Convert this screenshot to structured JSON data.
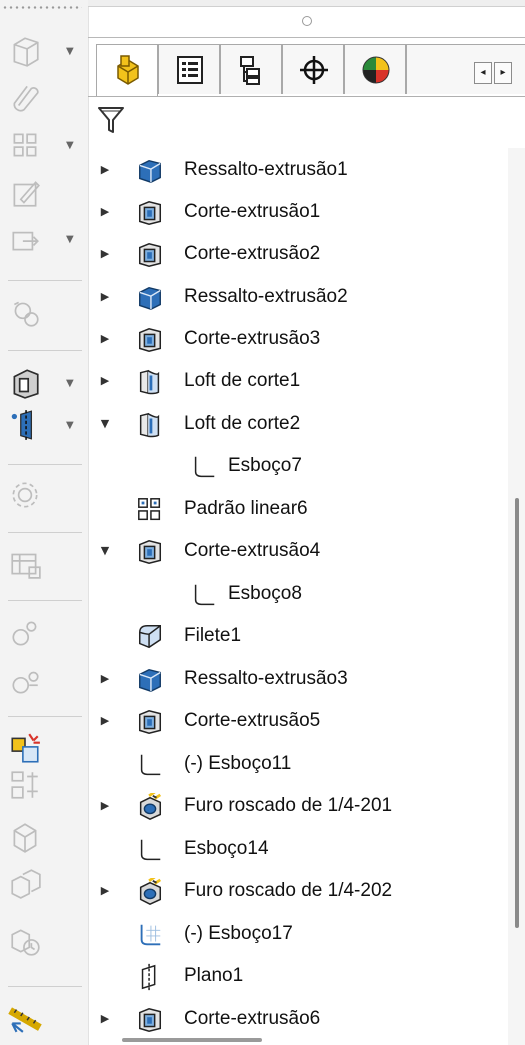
{
  "toolbar": {
    "items": [
      {
        "name": "extruded-boss-icon",
        "dropdown": true,
        "enabled": false
      },
      {
        "name": "paperclip-icon",
        "dropdown": false,
        "enabled": false
      },
      {
        "name": "linear-pattern-icon",
        "dropdown": true,
        "enabled": false
      },
      {
        "name": "sketch-edit-icon",
        "dropdown": false,
        "enabled": false
      },
      {
        "name": "move-body-icon",
        "dropdown": true,
        "enabled": false
      },
      {
        "name": "rebuild-icon",
        "dropdown": false,
        "enabled": false
      },
      {
        "name": "cut-extrude-icon",
        "dropdown": true,
        "enabled": true
      },
      {
        "name": "reference-plane-icon",
        "dropdown": true,
        "enabled": true
      },
      {
        "name": "gear-settings-icon",
        "dropdown": false,
        "enabled": false
      },
      {
        "name": "table-icon",
        "dropdown": false,
        "enabled": false
      },
      {
        "name": "mate-icon",
        "dropdown": false,
        "enabled": false
      },
      {
        "name": "mate-2-icon",
        "dropdown": false,
        "enabled": false
      },
      {
        "name": "instant3d-icon",
        "dropdown": false,
        "enabled": true
      },
      {
        "name": "align-icon",
        "dropdown": false,
        "enabled": false
      },
      {
        "name": "component-icon",
        "dropdown": false,
        "enabled": false
      },
      {
        "name": "assembly-icon",
        "dropdown": false,
        "enabled": false
      },
      {
        "name": "clock-icon",
        "dropdown": false,
        "enabled": false
      },
      {
        "name": "measure-icon",
        "dropdown": false,
        "enabled": true
      }
    ]
  },
  "tabs": [
    {
      "name": "tab-feature-manager",
      "icon": "feature-manager-icon",
      "active": true
    },
    {
      "name": "tab-property-manager",
      "icon": "property-manager-icon",
      "active": false
    },
    {
      "name": "tab-configuration-manager",
      "icon": "configuration-manager-icon",
      "active": false
    },
    {
      "name": "tab-dimxpert",
      "icon": "crosshair-icon",
      "active": false
    },
    {
      "name": "tab-display-manager",
      "icon": "display-manager-icon",
      "active": false
    }
  ],
  "scroll_buttons": {
    "left": "◂",
    "right": "▸"
  },
  "filter": {
    "icon": "filter-icon"
  },
  "tree": [
    {
      "label": "Ressalto-extrusão1",
      "icon": "boss-extrude",
      "expander": "▶",
      "indent": 0
    },
    {
      "label": "Corte-extrusão1",
      "icon": "cut-extrude",
      "expander": "▶",
      "indent": 0
    },
    {
      "label": "Corte-extrusão2",
      "icon": "cut-extrude",
      "expander": "▶",
      "indent": 0
    },
    {
      "label": "Ressalto-extrusão2",
      "icon": "boss-extrude",
      "expander": "▶",
      "indent": 0
    },
    {
      "label": "Corte-extrusão3",
      "icon": "cut-extrude",
      "expander": "▶",
      "indent": 0
    },
    {
      "label": "Loft de corte1",
      "icon": "loft-cut",
      "expander": "▶",
      "indent": 0
    },
    {
      "label": "Loft de corte2",
      "icon": "loft-cut",
      "expander": "▼",
      "indent": 0
    },
    {
      "label": "Esboço7",
      "icon": "sketch",
      "expander": "",
      "indent": 1
    },
    {
      "label": "Padrão linear6",
      "icon": "linear-pattern",
      "expander": "",
      "indent": 0
    },
    {
      "label": "Corte-extrusão4",
      "icon": "cut-extrude",
      "expander": "▼",
      "indent": 0
    },
    {
      "label": "Esboço8",
      "icon": "sketch",
      "expander": "",
      "indent": 1
    },
    {
      "label": "Filete1",
      "icon": "fillet",
      "expander": "",
      "indent": 0
    },
    {
      "label": "Ressalto-extrusão3",
      "icon": "boss-extrude",
      "expander": "▶",
      "indent": 0
    },
    {
      "label": "Corte-extrusão5",
      "icon": "cut-extrude",
      "expander": "▶",
      "indent": 0
    },
    {
      "label": "(-) Esboço11",
      "icon": "sketch",
      "expander": "",
      "indent": 0
    },
    {
      "label": "Furo roscado de 1/4-201",
      "icon": "hole-wizard",
      "expander": "▶",
      "indent": 0
    },
    {
      "label": "Esboço14",
      "icon": "sketch",
      "expander": "",
      "indent": 0
    },
    {
      "label": "Furo roscado de 1/4-202",
      "icon": "hole-wizard",
      "expander": "▶",
      "indent": 0
    },
    {
      "label": "(-) Esboço17",
      "icon": "sketch-3d",
      "expander": "",
      "indent": 0
    },
    {
      "label": "Plano1",
      "icon": "plane",
      "expander": "",
      "indent": 0
    },
    {
      "label": "Corte-extrusão6",
      "icon": "cut-extrude",
      "expander": "▶",
      "indent": 0
    }
  ],
  "colors": {
    "accent_blue": "#2d6fb8",
    "icon_dark": "#3b3b3b",
    "icon_disabled": "#bdbdbd",
    "highlight_yellow": "#f2c21b",
    "highlight_red": "#d8332a"
  }
}
